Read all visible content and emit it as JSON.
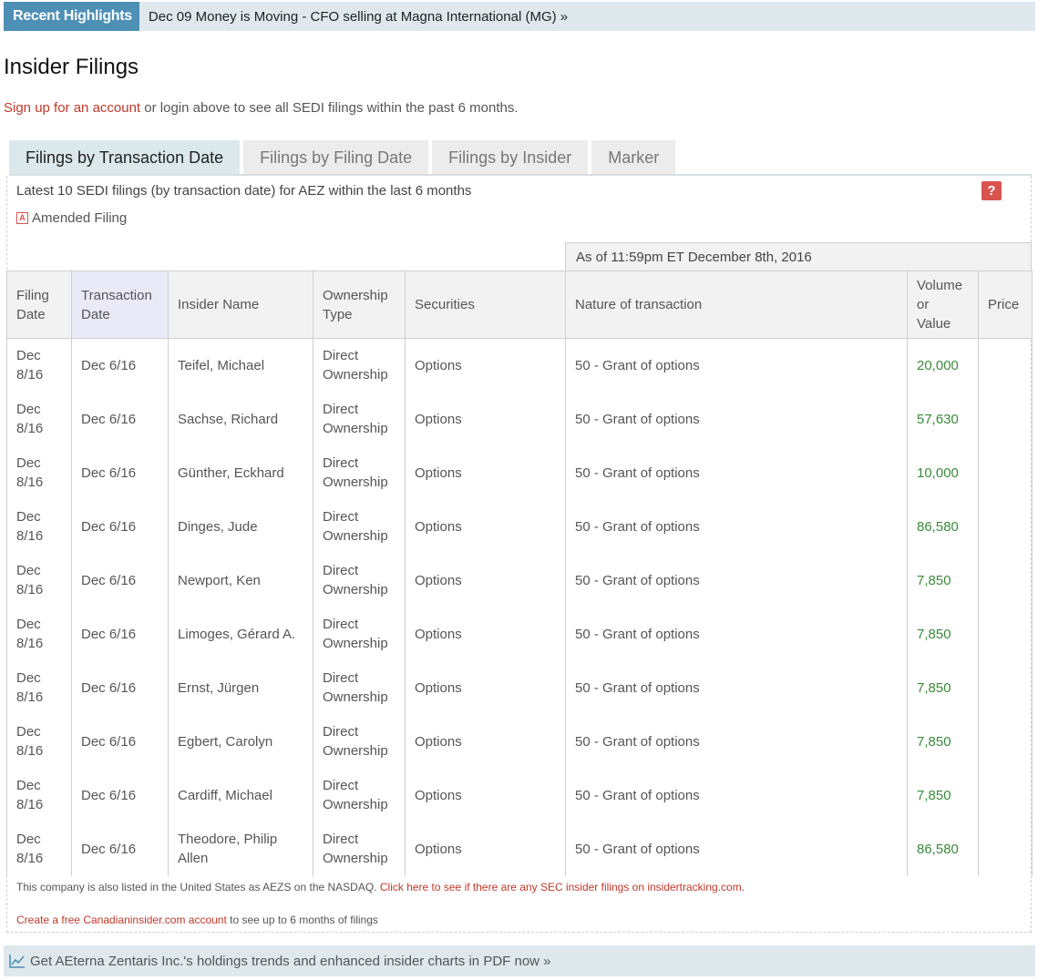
{
  "highlights": {
    "label": "Recent Highlights",
    "link": "Dec 09 Money is Moving - CFO selling at Magna International (MG) »"
  },
  "page_title": "Insider Filings",
  "signup": {
    "link": "Sign up for an account",
    "text": " or login above to see all SEDI filings within the past 6 months."
  },
  "tabs": [
    {
      "label": "Filings by Transaction Date",
      "active": true
    },
    {
      "label": "Filings by Filing Date",
      "active": false
    },
    {
      "label": "Filings by Insider",
      "active": false
    },
    {
      "label": "Marker",
      "active": false
    }
  ],
  "latest_text": "Latest 10 SEDI filings (by transaction date) for AEZ within the last 6 months",
  "help_label": "?",
  "amended": {
    "icon": "A",
    "label": "Amended Filing"
  },
  "as_of": "As of 11:59pm ET December 8th, 2016",
  "columns": {
    "filing_date": [
      "Filing",
      "Date"
    ],
    "transaction_date": [
      "Transaction",
      "Date"
    ],
    "insider_name": "Insider Name",
    "ownership_type": [
      "Ownership",
      "Type"
    ],
    "securities": "Securities",
    "nature": "Nature of transaction",
    "volume": [
      "Volume",
      "or",
      "Value"
    ],
    "price": "Price"
  },
  "rows": [
    {
      "filing_date": [
        "Dec",
        "8/16"
      ],
      "transaction_date": "Dec 6/16",
      "insider": [
        "Teifel, Michael"
      ],
      "ownership": [
        "Direct",
        "Ownership"
      ],
      "securities": "Options",
      "nature": "50 - Grant of options",
      "volume": "20,000",
      "price": ""
    },
    {
      "filing_date": [
        "Dec",
        "8/16"
      ],
      "transaction_date": "Dec 6/16",
      "insider": [
        "Sachse, Richard"
      ],
      "ownership": [
        "Direct",
        "Ownership"
      ],
      "securities": "Options",
      "nature": "50 - Grant of options",
      "volume": "57,630",
      "price": ""
    },
    {
      "filing_date": [
        "Dec",
        "8/16"
      ],
      "transaction_date": "Dec 6/16",
      "insider": [
        "Günther, Eckhard"
      ],
      "ownership": [
        "Direct",
        "Ownership"
      ],
      "securities": "Options",
      "nature": "50 - Grant of options",
      "volume": "10,000",
      "price": ""
    },
    {
      "filing_date": [
        "Dec",
        "8/16"
      ],
      "transaction_date": "Dec 6/16",
      "insider": [
        "Dinges, Jude"
      ],
      "ownership": [
        "Direct",
        "Ownership"
      ],
      "securities": "Options",
      "nature": "50 - Grant of options",
      "volume": "86,580",
      "price": ""
    },
    {
      "filing_date": [
        "Dec",
        "8/16"
      ],
      "transaction_date": "Dec 6/16",
      "insider": [
        "Newport, Ken"
      ],
      "ownership": [
        "Direct",
        "Ownership"
      ],
      "securities": "Options",
      "nature": "50 - Grant of options",
      "volume": "7,850",
      "price": ""
    },
    {
      "filing_date": [
        "Dec",
        "8/16"
      ],
      "transaction_date": "Dec 6/16",
      "insider": [
        "Limoges, Gérard A."
      ],
      "ownership": [
        "Direct",
        "Ownership"
      ],
      "securities": "Options",
      "nature": "50 - Grant of options",
      "volume": "7,850",
      "price": ""
    },
    {
      "filing_date": [
        "Dec",
        "8/16"
      ],
      "transaction_date": "Dec 6/16",
      "insider": [
        "Ernst, Jürgen"
      ],
      "ownership": [
        "Direct",
        "Ownership"
      ],
      "securities": "Options",
      "nature": "50 - Grant of options",
      "volume": "7,850",
      "price": ""
    },
    {
      "filing_date": [
        "Dec",
        "8/16"
      ],
      "transaction_date": "Dec 6/16",
      "insider": [
        "Egbert, Carolyn"
      ],
      "ownership": [
        "Direct",
        "Ownership"
      ],
      "securities": "Options",
      "nature": "50 - Grant of options",
      "volume": "7,850",
      "price": ""
    },
    {
      "filing_date": [
        "Dec",
        "8/16"
      ],
      "transaction_date": "Dec 6/16",
      "insider": [
        "Cardiff, Michael"
      ],
      "ownership": [
        "Direct",
        "Ownership"
      ],
      "securities": "Options",
      "nature": "50 - Grant of options",
      "volume": "7,850",
      "price": ""
    },
    {
      "filing_date": [
        "Dec",
        "8/16"
      ],
      "transaction_date": "Dec 6/16",
      "insider": [
        "Theodore, Philip",
        "Allen"
      ],
      "ownership": [
        "Direct",
        "Ownership"
      ],
      "securities": "Options",
      "nature": "50 - Grant of options",
      "volume": "86,580",
      "price": ""
    }
  ],
  "nasdaq": {
    "text": "This company is also listed in the United States as AEZS on the NASDAQ. ",
    "link": "Click here to see if there are any SEC insider filings on insidertracking.com."
  },
  "create": {
    "link": "Create a free Canadianinsider.com account",
    "text": " to see up to 6 months of filings"
  },
  "pdf_bar": {
    "icon": "line-chart-icon",
    "text": "Get AEterna Zentaris Inc.'s holdings trends and enhanced insider charts in PDF now »"
  },
  "colors": {
    "highlight_label_bg": "#4d8fb5",
    "bar_bg": "#dfe8ec",
    "link_red": "#c0392b",
    "volume_green": "#3a8a3a",
    "help_red": "#d9534f"
  }
}
